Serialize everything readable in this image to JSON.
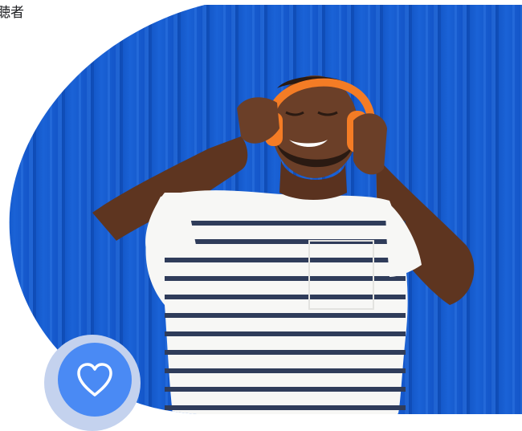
{
  "page": {
    "caption": "聴者"
  },
  "hero": {
    "subject": "man-listening-to-music-with-orange-headphones",
    "colors": {
      "wall": "#1a62d6",
      "wall_dark": "#0f4fbd",
      "shirt": "#f7f7f5",
      "stripes": "#2f3c5a",
      "skin": "#6b3f28",
      "headphones": "#f47c25"
    }
  },
  "favorite": {
    "icon": "heart-icon",
    "colors": {
      "outer_ring": "#c4d2ee",
      "button": "#4a8af4",
      "icon": "#ffffff"
    }
  }
}
